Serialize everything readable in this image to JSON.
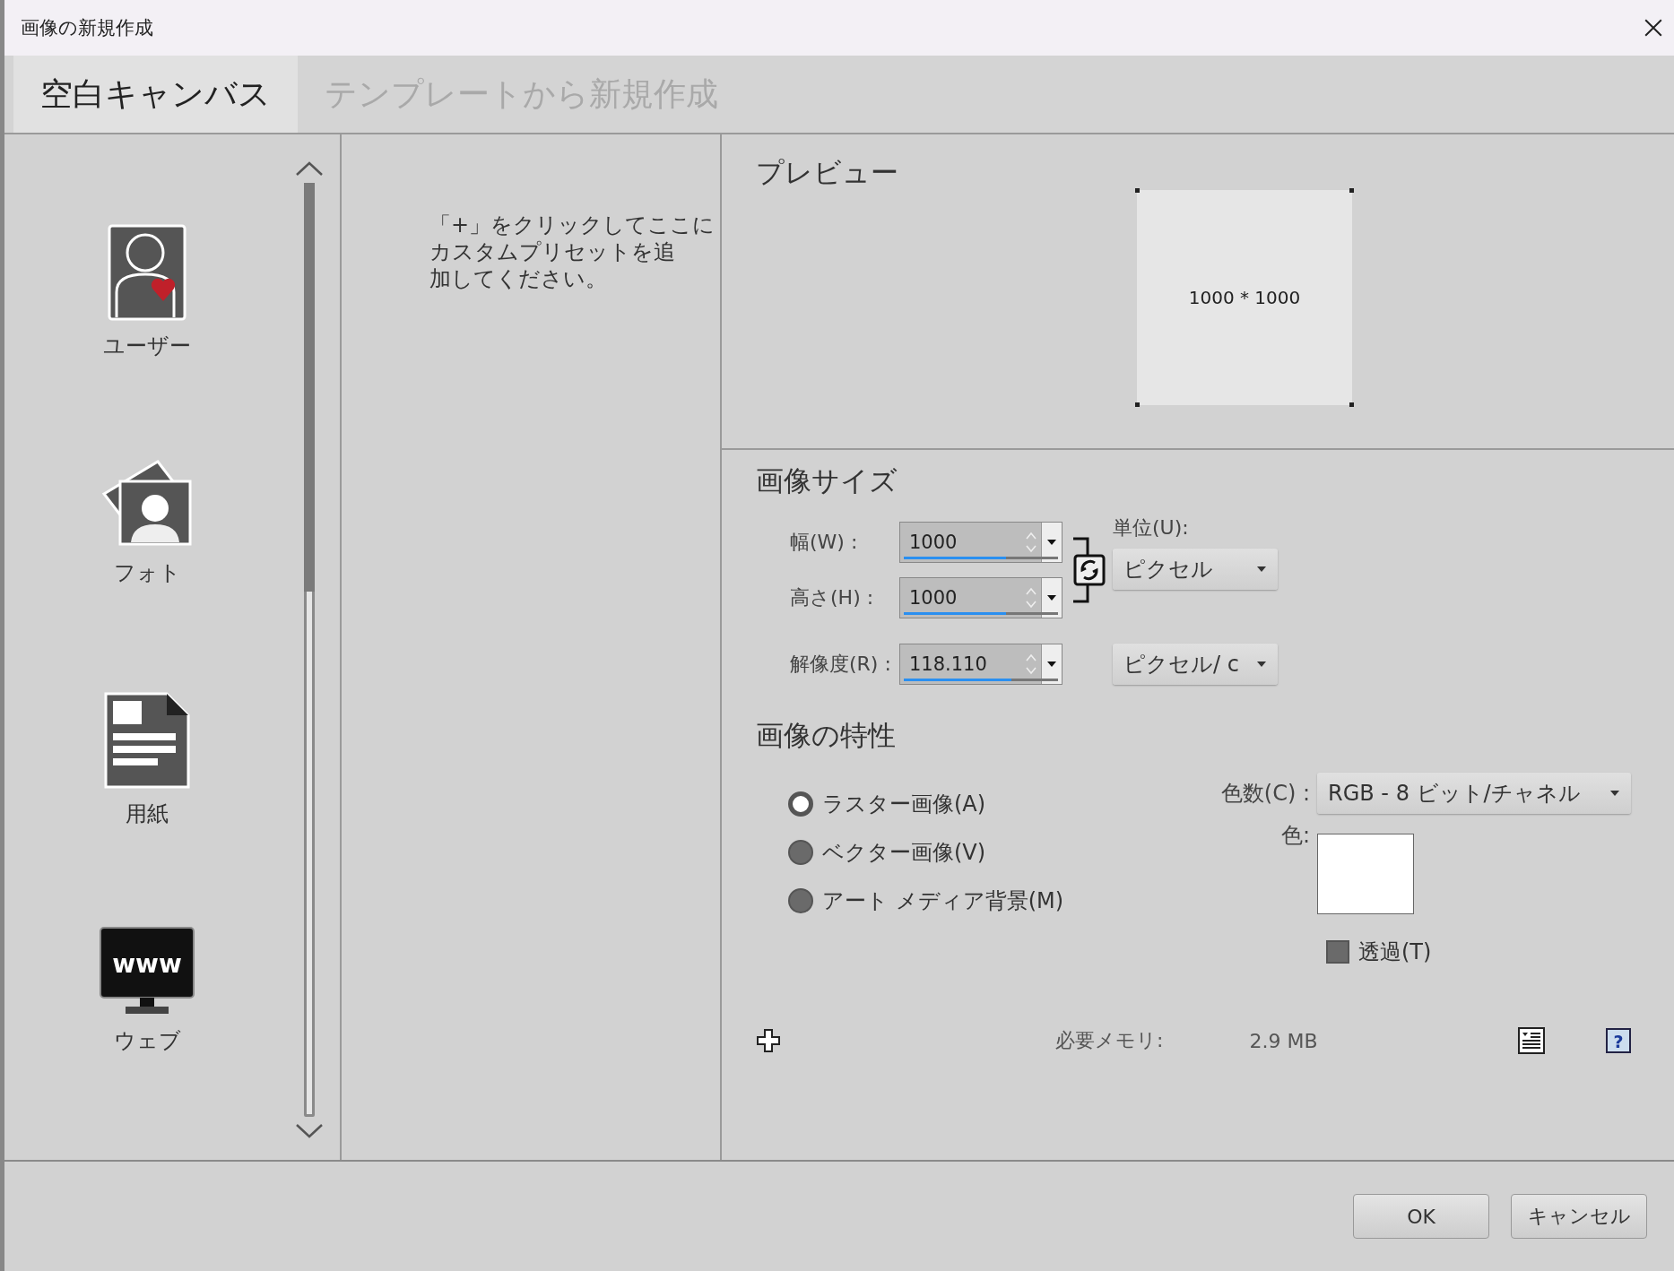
{
  "window": {
    "title": "画像の新規作成"
  },
  "tabs": [
    {
      "label": "空白キャンバス",
      "selected": true
    },
    {
      "label": "テンプレートから新規作成",
      "selected": false
    }
  ],
  "categories": [
    {
      "label": "ユーザー",
      "kind": "user"
    },
    {
      "label": "フォト",
      "kind": "photo"
    },
    {
      "label": "用紙",
      "kind": "paper"
    },
    {
      "label": "ウェブ",
      "kind": "web",
      "icon_text": "www"
    }
  ],
  "preset_hint": {
    "lines": [
      "「+」をクリックしてここに",
      "カスタムプリセットを追",
      "加してください。"
    ]
  },
  "preview": {
    "title": "プレビュー",
    "size_label": "1000 * 1000"
  },
  "image_size": {
    "title": "画像サイズ",
    "fields": [
      {
        "label": "幅(W) :",
        "value": "1000",
        "level": 0.66
      },
      {
        "label": "高さ(H) :",
        "value": "1000",
        "level": 0.66
      },
      {
        "label": "解像度(R) :",
        "value": "118.110",
        "level": 0.7
      }
    ],
    "unit_label": "単位(U):",
    "unit": "ピクセル",
    "resolution_unit": "ピクセル/ c"
  },
  "image_properties": {
    "title": "画像の特性",
    "types": [
      {
        "label": "ラスター画像(A)",
        "selected": true
      },
      {
        "label": "ベクター画像(V)",
        "selected": false
      },
      {
        "label": "アート メディア背景(M)",
        "selected": false
      }
    ],
    "color_depth_label": "色数(C) :",
    "color_depth": "RGB - 8 ビット/チャネル",
    "color_label": "色:",
    "transparent": {
      "label": "透過(T)",
      "checked": false
    }
  },
  "memory": {
    "label": "必要メモリ:",
    "value": "2.9 MB",
    "help_symbol": "?"
  },
  "buttons": [
    "OK",
    "キャンセル"
  ]
}
